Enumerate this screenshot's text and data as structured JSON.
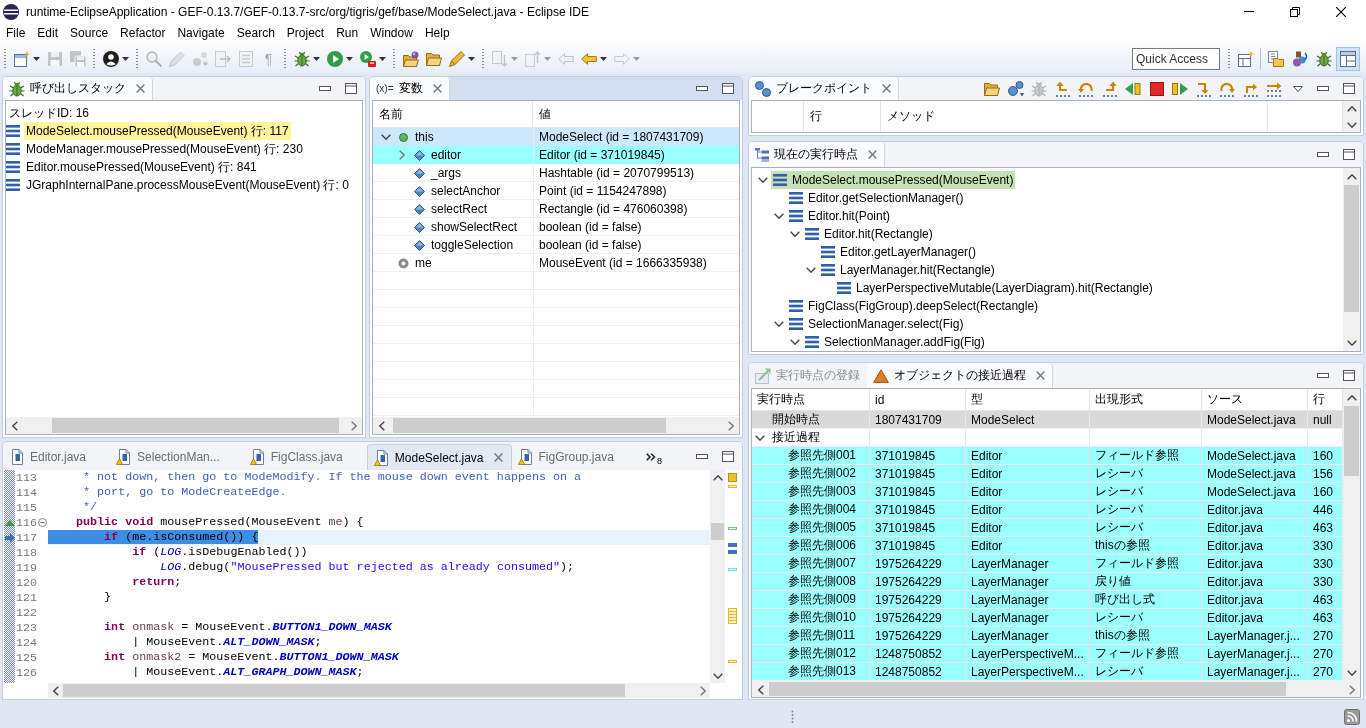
{
  "window": {
    "title": "runtime-EclipseApplication - GEF-0.13.7/GEF-0.13.7-src/org/tigris/gef/base/ModeSelect.java - Eclipse IDE"
  },
  "menu": [
    "File",
    "Edit",
    "Source",
    "Refactor",
    "Navigate",
    "Search",
    "Project",
    "Run",
    "Window",
    "Help"
  ],
  "toolbar": {
    "groups": [
      [
        {
          "disabled": false,
          "dropdown": true
        },
        {
          "disabled": true
        },
        {
          "disabled": true
        }
      ],
      [
        {
          "disabled": false,
          "dropdown": true
        }
      ],
      [
        {
          "disabled": true
        },
        {
          "disabled": true
        },
        {
          "disabled": true
        },
        {
          "disabled": true
        },
        {
          "disabled": true
        },
        {
          "disabled": true,
          "glyph": "¶"
        }
      ],
      [
        {
          "disabled": false,
          "dropdown": true
        },
        {
          "disabled": false,
          "dropdown": true
        },
        {
          "disabled": false,
          "dropdown": true
        }
      ],
      [
        {
          "disabled": false
        },
        {
          "disabled": false
        },
        {
          "disabled": false,
          "dropdown": true
        }
      ],
      [
        {
          "disabled": true,
          "dropdown": true
        },
        {
          "disabled": true,
          "dropdown": true
        },
        {
          "disabled": true
        },
        {
          "disabled": false,
          "dropdown": true
        },
        {
          "disabled": true,
          "dropdown": true
        }
      ]
    ],
    "quick_access": {
      "placeholder": "Quick Access"
    },
    "perspectives": [
      {
        "selected": false
      },
      {
        "selected": false
      },
      {
        "selected": false
      },
      {
        "selected": true
      }
    ]
  },
  "call_stack": {
    "active": false,
    "tabs": [
      {
        "label": "呼び出しスタック",
        "selected": true
      }
    ],
    "thread": "スレッドID: 16",
    "frames": [
      {
        "label": "ModeSelect.mousePressed(MouseEvent) 行: 117",
        "highlighted": true
      },
      {
        "label": "ModeManager.mousePressed(MouseEvent) 行: 230",
        "highlighted": false
      },
      {
        "label": "Editor.mousePressed(MouseEvent) 行: 841",
        "highlighted": false
      },
      {
        "label": "JGraphInternalPane.processMouseEvent(MouseEvent) 行: 0",
        "highlighted": false
      }
    ]
  },
  "variables": {
    "active": true,
    "tabs": [
      {
        "icon_glyph": "(x)=",
        "label": "変数",
        "selected": true
      }
    ],
    "columns": [
      "名前",
      "値"
    ],
    "rows": [
      {
        "kind": "object",
        "name": "this",
        "value": "ModeSelect (id = 1807431709)",
        "expanded": true,
        "selected": true,
        "highlighted": false,
        "children": [
          {
            "kind": "field",
            "name": "editor",
            "value": "Editor (id = 371019845)",
            "expanded": false,
            "selected": false,
            "highlighted": true
          },
          {
            "kind": "field",
            "name": "_args",
            "value": "Hashtable (id = 2070799513)",
            "selected": false,
            "highlighted": false
          },
          {
            "kind": "field",
            "name": "selectAnchor",
            "value": "Point (id = 1154247898)",
            "selected": false,
            "highlighted": false
          },
          {
            "kind": "field",
            "name": "selectRect",
            "value": "Rectangle (id = 476060398)",
            "selected": false,
            "highlighted": false
          },
          {
            "kind": "field",
            "name": "showSelectRect",
            "value": "boolean (id = false)",
            "selected": false,
            "highlighted": false
          },
          {
            "kind": "field",
            "name": "toggleSelection",
            "value": "boolean (id = false)",
            "selected": false,
            "highlighted": false
          }
        ]
      },
      {
        "kind": "local",
        "name": "me",
        "value": "MouseEvent (id = 1666335938)",
        "selected": false,
        "highlighted": false
      }
    ]
  },
  "editor": {
    "tabs": [
      {
        "label": "Editor.java",
        "selected": false,
        "warning": false
      },
      {
        "label": "SelectionMan...",
        "selected": false,
        "warning": true
      },
      {
        "label": "FigClass.java",
        "selected": false,
        "warning": true
      },
      {
        "label": "ModeSelect.java",
        "selected": true,
        "warning": true
      },
      {
        "label": "FigGroup.java",
        "selected": false,
        "warning": true
      }
    ],
    "overflow_count": "8",
    "lines": [
      {
        "number": "113",
        "current": false,
        "tokens": [
          {
            "kind": "comment",
            "text": "     * not down, then go to ModeModify. If the mouse down event happens on a"
          }
        ]
      },
      {
        "number": "114",
        "current": false,
        "tokens": [
          {
            "kind": "comment",
            "text": "     * port, go to ModeCreateEdge."
          }
        ]
      },
      {
        "number": "115",
        "current": false,
        "tokens": [
          {
            "kind": "comment",
            "text": "     */"
          }
        ]
      },
      {
        "number": "116",
        "current": false,
        "override": true,
        "fold": {
          "expanded": true
        },
        "tokens": [
          {
            "kind": "keyword",
            "text": "    public void"
          },
          {
            "kind": "plain",
            "text": " mousePressed(MouseEvent "
          },
          {
            "kind": "param",
            "text": "me"
          },
          {
            "kind": "plain",
            "text": ") {"
          }
        ]
      },
      {
        "number": "117",
        "current": true,
        "text_selected": true,
        "tokens": [
          {
            "kind": "keyword",
            "text": "        if"
          },
          {
            "kind": "plain",
            "text": " (me.isConsumed()) {"
          }
        ]
      },
      {
        "number": "118",
        "current": false,
        "tokens": [
          {
            "kind": "keyword",
            "text": "            if"
          },
          {
            "kind": "plain",
            "text": " ("
          },
          {
            "kind": "static",
            "text": "LOG"
          },
          {
            "kind": "plain",
            "text": ".isDebugEnabled())"
          }
        ]
      },
      {
        "number": "119",
        "current": false,
        "tokens": [
          {
            "kind": "static",
            "text": "                LOG"
          },
          {
            "kind": "plain",
            "text": ".debug("
          },
          {
            "kind": "string",
            "text": "\"MousePressed but rejected as already consumed\""
          },
          {
            "kind": "plain",
            "text": ");"
          }
        ]
      },
      {
        "number": "120",
        "current": false,
        "tokens": [
          {
            "kind": "keyword",
            "text": "            return"
          },
          {
            "kind": "plain",
            "text": ";"
          }
        ]
      },
      {
        "number": "121",
        "current": false,
        "tokens": [
          {
            "kind": "plain",
            "text": "        }"
          }
        ]
      },
      {
        "number": "122",
        "current": false
      },
      {
        "number": "123",
        "current": false,
        "tokens": [
          {
            "kind": "keyword",
            "text": "        int"
          },
          {
            "kind": "local",
            "text": " onmask"
          },
          {
            "kind": "plain",
            "text": " = MouseEvent."
          },
          {
            "kind": "constant",
            "text": "BUTTON1_DOWN_MASK"
          }
        ]
      },
      {
        "number": "124",
        "current": false,
        "tokens": [
          {
            "kind": "plain",
            "text": "            | MouseEvent."
          },
          {
            "kind": "constant",
            "text": "ALT_DOWN_MASK"
          },
          {
            "kind": "plain",
            "text": ";"
          }
        ]
      },
      {
        "number": "125",
        "current": false,
        "tokens": [
          {
            "kind": "keyword",
            "text": "        int"
          },
          {
            "kind": "local",
            "text": " onmask2"
          },
          {
            "kind": "plain",
            "text": " = MouseEvent."
          },
          {
            "kind": "constant",
            "text": "BUTTON1_DOWN_MASK"
          }
        ]
      },
      {
        "number": "126",
        "current": false,
        "tokens": [
          {
            "kind": "plain",
            "text": "            | MouseEvent."
          },
          {
            "kind": "constant",
            "text": "ALT_GRAPH_DOWN_MASK"
          },
          {
            "kind": "plain",
            "text": ";"
          }
        ]
      }
    ]
  },
  "breakpoints": {
    "active": false,
    "tabs": [
      {
        "label": "ブレークポイント",
        "selected": true
      }
    ],
    "toolbar": [
      {
        "disabled": false
      },
      {
        "disabled": false
      },
      {
        "disabled": true
      },
      {
        "disabled": false
      },
      {
        "disabled": false
      },
      {
        "disabled": false
      },
      {
        "disabled": false
      },
      {
        "disabled": false
      },
      {
        "disabled": false
      },
      {
        "disabled": false
      },
      {
        "disabled": false
      },
      {
        "disabled": false
      },
      {
        "disabled": false
      }
    ],
    "columns": [
      "行",
      "メソッド"
    ]
  },
  "execution_points": {
    "active": false,
    "tabs": [
      {
        "label": "現在の実行時点",
        "selected": true
      }
    ],
    "tree": [
      {
        "label": "ModeSelect.mousePressed(MouseEvent)",
        "expanded": true,
        "highlighted": true,
        "children": [
          {
            "label": "Editor.getSelectionManager()",
            "highlighted": false
          },
          {
            "label": "Editor.hit(Point)",
            "expanded": true,
            "highlighted": false,
            "children": [
              {
                "label": "Editor.hit(Rectangle)",
                "expanded": true,
                "highlighted": false,
                "children": [
                  {
                    "label": "Editor.getLayerManager()",
                    "highlighted": false
                  },
                  {
                    "label": "LayerManager.hit(Rectangle)",
                    "expanded": true,
                    "highlighted": false,
                    "children": [
                      {
                        "label": "LayerPerspectiveMutable(LayerDiagram).hit(Rectangle)",
                        "highlighted": false
                      }
                    ]
                  }
                ]
              }
            ]
          },
          {
            "label": "FigClass(FigGroup).deepSelect(Rectangle)",
            "highlighted": false
          },
          {
            "label": "SelectionManager.select(Fig)",
            "expanded": true,
            "highlighted": false,
            "children": [
              {
                "label": "SelectionManager.addFig(Fig)",
                "expanded": true,
                "highlighted": false
              }
            ]
          }
        ]
      }
    ]
  },
  "object_trace": {
    "active": false,
    "tabs": [
      {
        "label": "実行時点の登録",
        "selected": false
      },
      {
        "label": "オブジェクトの接近過程",
        "selected": true
      }
    ],
    "columns": [
      "実行時点",
      "id",
      "型",
      "出現形式",
      "ソース",
      "行"
    ],
    "rows": [
      {
        "point": "開始時点",
        "id": "1807431709",
        "type": "ModeSelect",
        "source": "ModeSelect.java",
        "line": "null",
        "selected": true,
        "highlighted": false
      },
      {
        "point": "接近過程",
        "expanded": true,
        "selected": false,
        "highlighted": false,
        "children": [
          {
            "point": "参照先側001",
            "id": "371019845",
            "type": "Editor",
            "occurrence": "フィールド参照",
            "source": "ModeSelect.java",
            "line": "160",
            "selected": false,
            "highlighted": true
          },
          {
            "point": "参照先側002",
            "id": "371019845",
            "type": "Editor",
            "occurrence": "レシーバ",
            "source": "ModeSelect.java",
            "line": "156",
            "selected": false,
            "highlighted": true
          },
          {
            "point": "参照先側003",
            "id": "371019845",
            "type": "Editor",
            "occurrence": "レシーバ",
            "source": "ModeSelect.java",
            "line": "160",
            "selected": false,
            "highlighted": true
          },
          {
            "point": "参照先側004",
            "id": "371019845",
            "type": "Editor",
            "occurrence": "レシーバ",
            "source": "Editor.java",
            "line": "446",
            "selected": false,
            "highlighted": true
          },
          {
            "point": "参照先側005",
            "id": "371019845",
            "type": "Editor",
            "occurrence": "レシーバ",
            "source": "Editor.java",
            "line": "463",
            "selected": false,
            "highlighted": true
          },
          {
            "point": "参照先側006",
            "id": "371019845",
            "type": "Editor",
            "occurrence": "thisの参照",
            "source": "Editor.java",
            "line": "330",
            "selected": false,
            "highlighted": true
          },
          {
            "point": "参照先側007",
            "id": "1975264229",
            "type": "LayerManager",
            "occurrence": "フィールド参照",
            "source": "Editor.java",
            "line": "330",
            "selected": false,
            "highlighted": true
          },
          {
            "point": "参照先側008",
            "id": "1975264229",
            "type": "LayerManager",
            "occurrence": "戻り値",
            "source": "Editor.java",
            "line": "330",
            "selected": false,
            "highlighted": true
          },
          {
            "point": "参照先側009",
            "id": "1975264229",
            "type": "LayerManager",
            "occurrence": "呼び出し式",
            "source": "Editor.java",
            "line": "463",
            "selected": false,
            "highlighted": true
          },
          {
            "point": "参照先側010",
            "id": "1975264229",
            "type": "LayerManager",
            "occurrence": "レシーバ",
            "source": "Editor.java",
            "line": "463",
            "selected": false,
            "highlighted": true
          },
          {
            "point": "参照先側011",
            "id": "1975264229",
            "type": "LayerManager",
            "occurrence": "thisの参照",
            "source": "LayerManager.j...",
            "line": "270",
            "selected": false,
            "highlighted": true
          },
          {
            "point": "参照先側012",
            "id": "1248750852",
            "type": "LayerPerspectiveM...",
            "occurrence": "フィールド参照",
            "source": "LayerManager.j...",
            "line": "270",
            "selected": false,
            "highlighted": true
          },
          {
            "point": "参照先側013",
            "id": "1248750852",
            "type": "LayerPerspectiveM...",
            "occurrence": "レシーバ",
            "source": "LayerManager.j...",
            "line": "270",
            "selected": false,
            "highlighted": true
          }
        ]
      }
    ]
  }
}
